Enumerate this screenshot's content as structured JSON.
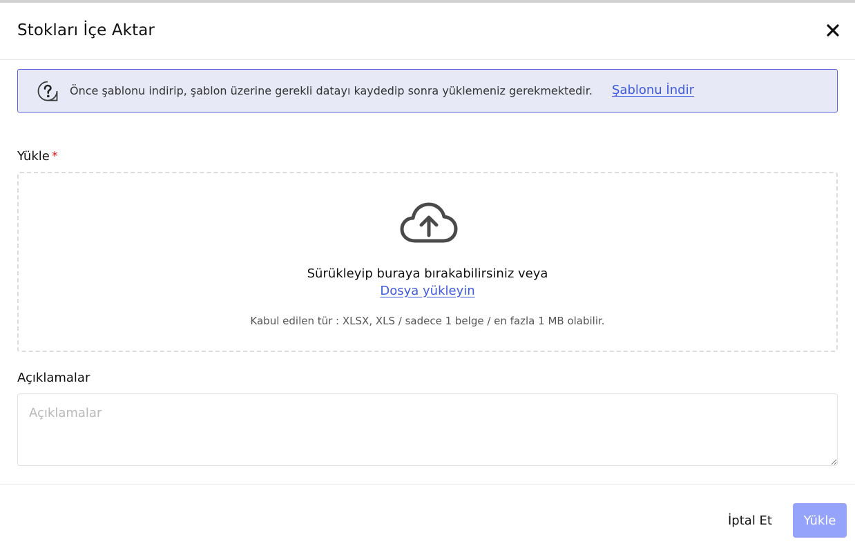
{
  "modal": {
    "title": "Stokları İçe Aktar",
    "close_icon": "close-icon"
  },
  "info_banner": {
    "icon": "question-circle-icon",
    "text": "Önce şablonu indirip, şablon üzerine gerekli datayı kaydedip sonra yüklemeniz gerekmektedir.",
    "link_label": "Şablonu İndir",
    "background_color": "#e7eaf6",
    "border_color": "#5763e0"
  },
  "upload": {
    "label": "Yükle",
    "required_mark": "*",
    "icon": "cloud-upload-icon",
    "drop_text": "Sürükleyip buraya bırakabilirsiniz veya",
    "link_label": "Dosya yükleyin",
    "hint": "Kabul edilen tür : XLSX, XLS / sadece 1 belge / en fazla 1 MB olabilir."
  },
  "notes": {
    "label": "Açıklamalar",
    "placeholder": "Açıklamalar",
    "value": ""
  },
  "footer": {
    "cancel_label": "İptal Et",
    "submit_label": "Yükle",
    "submit_color": "#96a3fb",
    "link_color": "#3f59e0"
  }
}
